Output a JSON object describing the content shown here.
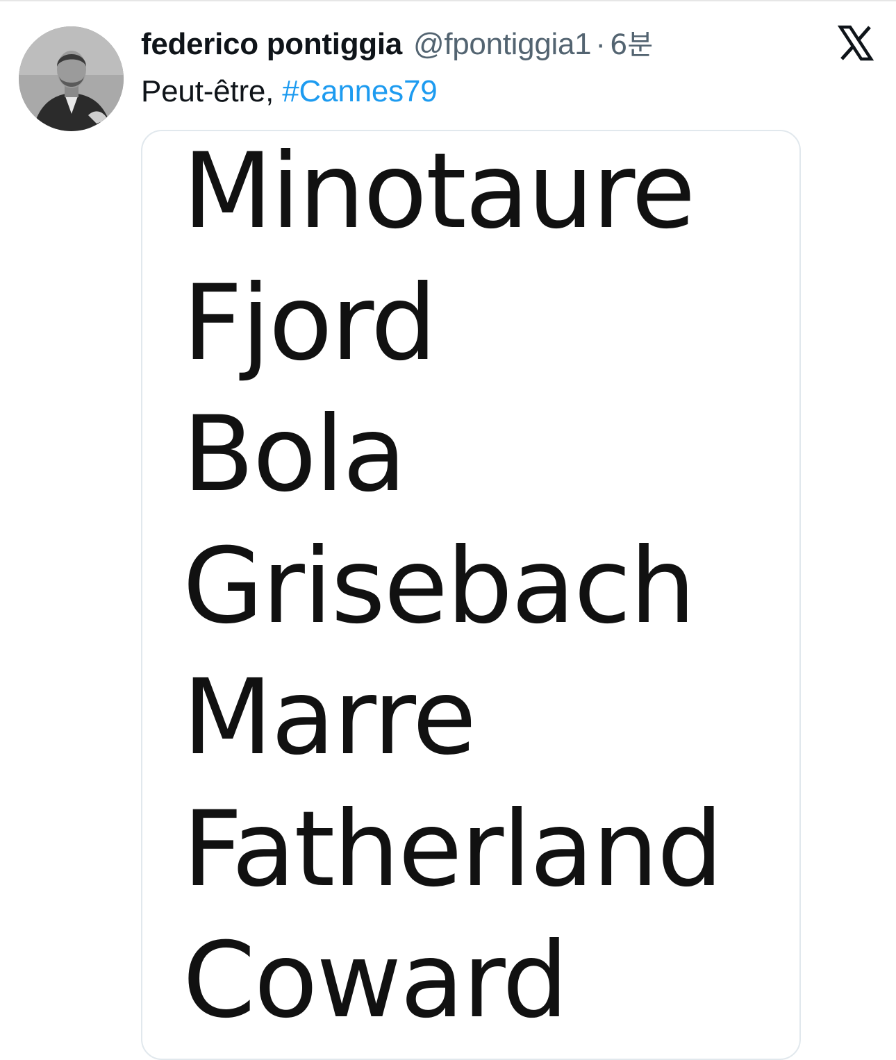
{
  "tweet": {
    "author": {
      "display_name": "federico pontiggia",
      "handle": "@fpontiggia1",
      "avatar_icon": "profile-photo-icon"
    },
    "separator": "·",
    "time": "6분",
    "text": "Peut-être,",
    "hashtag": "#Cannes79",
    "logo_icon": "x-logo-icon",
    "image_words": [
      "Minotaure",
      "Fjord",
      "Bola",
      "Grisebach",
      "Marre",
      "Fatherland",
      "Coward"
    ]
  },
  "colors": {
    "text_primary": "#0f1419",
    "text_secondary": "#536471",
    "hashtag": "#1d9bf0",
    "card_border": "#e1e8ed"
  }
}
